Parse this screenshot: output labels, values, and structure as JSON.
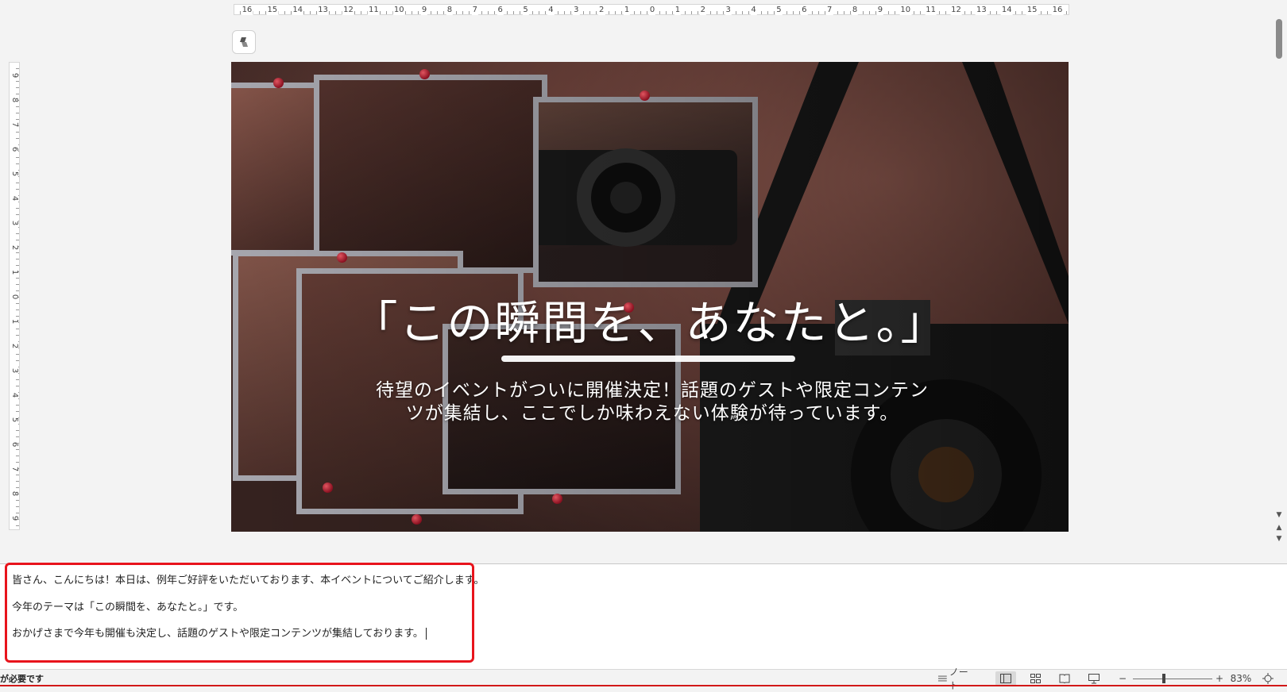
{
  "ruler": {
    "horizontal": [
      "16",
      "15",
      "14",
      "13",
      "12",
      "11",
      "10",
      "9",
      "8",
      "7",
      "6",
      "5",
      "4",
      "3",
      "2",
      "1",
      "0",
      "1",
      "2",
      "3",
      "4",
      "5",
      "6",
      "7",
      "8",
      "9",
      "10",
      "11",
      "12",
      "13",
      "14",
      "15",
      "16"
    ],
    "vertical": [
      "9",
      "8",
      "7",
      "6",
      "5",
      "4",
      "3",
      "2",
      "1",
      "0",
      "1",
      "2",
      "3",
      "4",
      "5",
      "6",
      "7",
      "8",
      "9"
    ]
  },
  "slide": {
    "title": "「この瞬間を、あなたと。」",
    "subtitle_line1": "待望のイベントがついに開催決定！話題のゲストや限定コンテン",
    "subtitle_line2": "ツが集結し、ここでしか味わえない体験が待っています。"
  },
  "notes": {
    "line1": "皆さん、こんにちは！本日は、例年ご好評をいただいております、本イベントについてご紹介します。",
    "line2": "今年のテーマは「この瞬間を、あなたと。」です。",
    "line3": "おかげさまで今年も開催も決定し、話題のゲストや限定コンテンツが集結しております。"
  },
  "statusbar": {
    "left_text": "が必要です",
    "notes_label": "ノート",
    "zoom_minus": "−",
    "zoom_plus": "+",
    "zoom_level": "83%"
  },
  "icons": {
    "copilot": "copilot-icon",
    "notes": "notes-icon",
    "normal_view": "normal-view-icon",
    "slide_sorter": "slide-sorter-icon",
    "reading_view": "reading-view-icon",
    "slideshow": "slideshow-icon",
    "fit": "fit-to-window-icon"
  },
  "colors": {
    "highlight_border": "#e8141c",
    "status_redline": "#d21818"
  }
}
